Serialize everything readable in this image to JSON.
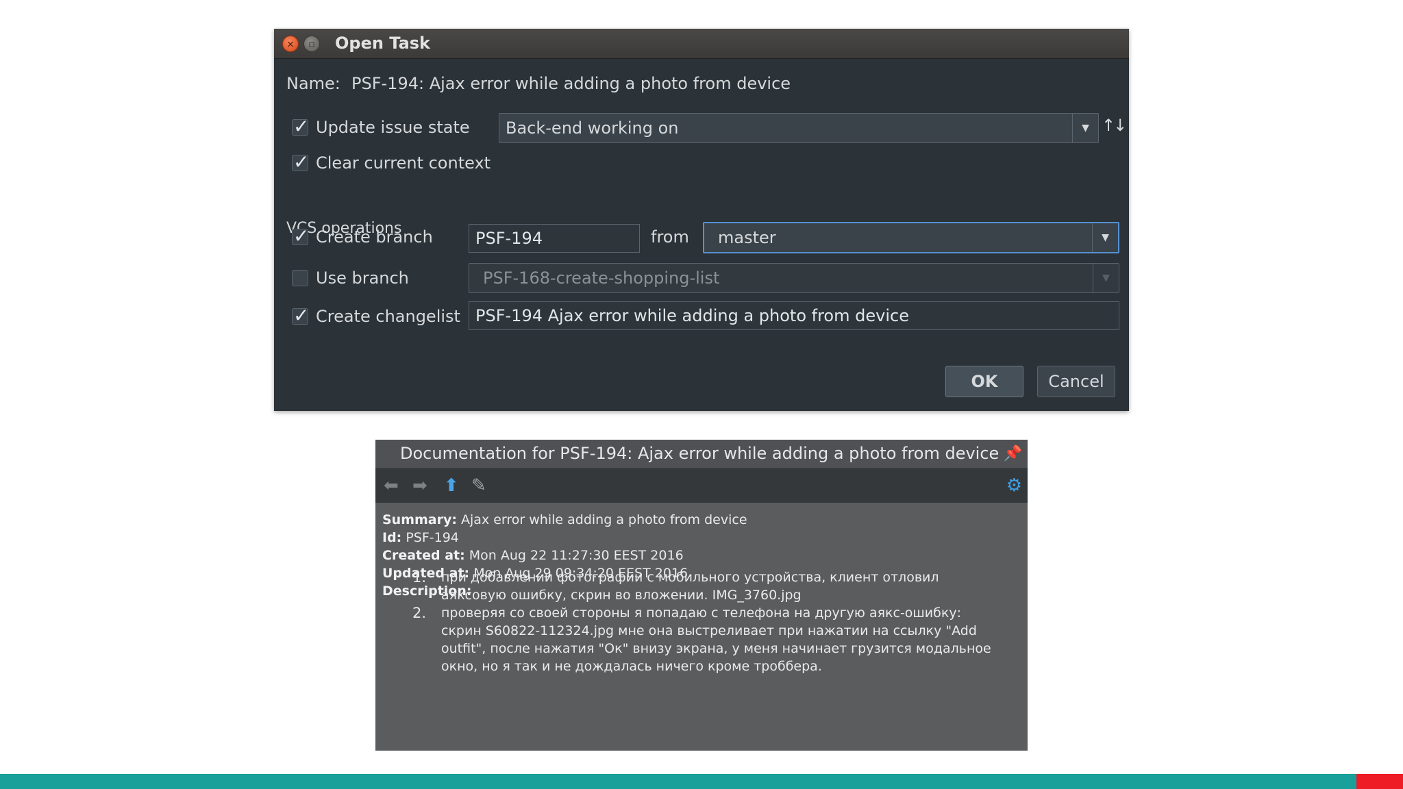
{
  "dialog": {
    "title": "Open Task",
    "name_label": "Name:",
    "name_value": "PSF-194: Ajax error while adding a photo from device",
    "update_issue_state": {
      "label": "Update issue state",
      "checked": true,
      "value": "Back-end working on"
    },
    "clear_context": {
      "label": "Clear current context",
      "checked": true
    },
    "vcs_label": "VCS operations",
    "create_branch": {
      "label": "Create branch",
      "checked": true,
      "value": "PSF-194",
      "from_label": "from",
      "from_value": "master"
    },
    "use_branch": {
      "label": "Use branch",
      "checked": false,
      "value": "PSF-168-create-shopping-list"
    },
    "create_changelist": {
      "label": "Create changelist",
      "checked": true,
      "value": "PSF-194 Ajax error while adding a photo from device"
    },
    "ok_label": "OK",
    "cancel_label": "Cancel"
  },
  "doc": {
    "title": "Documentation for PSF-194: Ajax error while adding a photo from device",
    "summary_label": "Summary:",
    "summary": "Ajax error while adding a photo from device",
    "id_label": "Id:",
    "id": "PSF-194",
    "created_label": "Created at:",
    "created": "Mon Aug 22 11:27:30 EEST 2016",
    "updated_label": "Updated at:",
    "updated": "Mon Aug 29 09:34:20 EEST 2016",
    "description_label": "Description:",
    "items": [
      {
        "num": "1.",
        "text": "при добавлении фотографии с мобильного устройства, клиент отловил аяксовую ошибку, скрин во вложении. IMG_3760.jpg"
      },
      {
        "num": "2.",
        "text": "проверяя со своей стороны я попадаю с телефона на другую аякс-ошибку: скрин S60822-112324.jpg мне она выстреливает при нажатии на ссылку \"Add outfit\", после нажатия \"Ок\" внизу экрана, у меня начинает грузится модальное окно, но я так и не дождалась ничего кроме троббера."
      }
    ]
  },
  "colors": {
    "footer_teal": "#19a09a",
    "footer_red": "#ee1c25",
    "focus_blue": "#5592d3"
  }
}
